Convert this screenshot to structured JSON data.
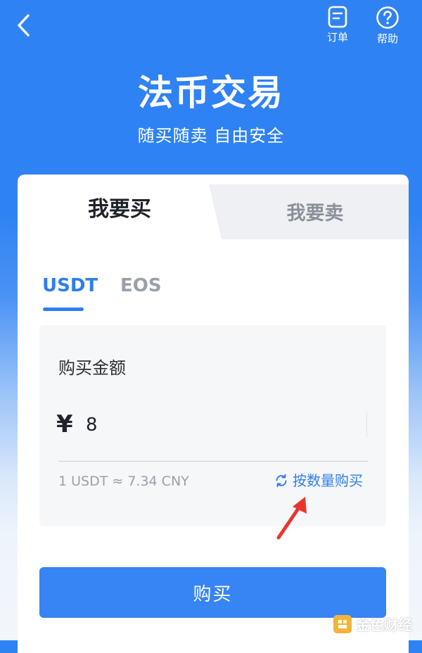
{
  "colors": {
    "brand_blue": "#2f82f3",
    "accent_blue": "#2f7ef0",
    "button_blue": "#3784f4",
    "annotation_red": "#e8362e",
    "watermark_gold": "#f2b53a"
  },
  "header": {
    "back_icon": "chevron-left-icon",
    "orders": {
      "icon": "order-document-icon",
      "label": "订单"
    },
    "help": {
      "icon": "question-circle-icon",
      "label": "帮助"
    },
    "title": "法币交易",
    "subtitle": "随买随卖 自由安全"
  },
  "trade_tabs": [
    {
      "label": "我要买",
      "active": true
    },
    {
      "label": "我要卖",
      "active": false
    }
  ],
  "coin_tabs": [
    {
      "label": "USDT",
      "active": true
    },
    {
      "label": "EOS",
      "active": false
    }
  ],
  "purchase": {
    "amount_label": "购买金额",
    "currency_symbol": "¥",
    "amount_value": "8",
    "rate_text": "1 USDT ≈ 7.34 CNY",
    "switch_icon": "refresh-icon",
    "switch_label": "按数量购买",
    "buy_button": "购买"
  },
  "annotation": {
    "icon": "arrow-pointer-icon"
  },
  "watermark": {
    "text": "金色财经",
    "logo_icon": "jinse-logo-icon"
  }
}
